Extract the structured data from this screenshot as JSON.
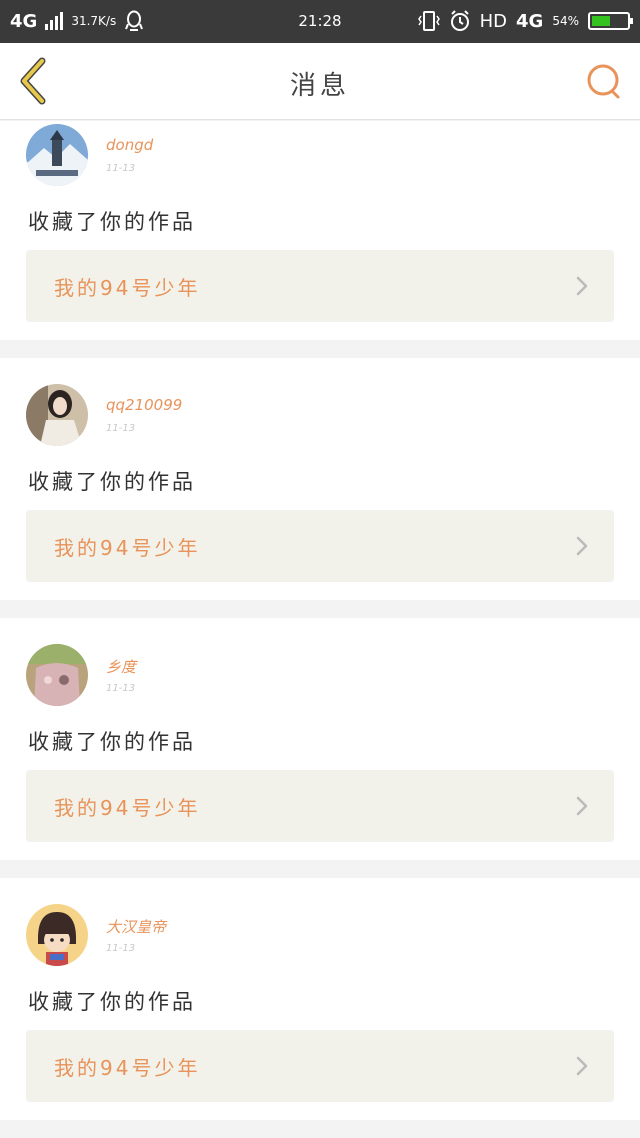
{
  "status_bar": {
    "network": "4G",
    "speed": "31.7K/s",
    "time": "21:28",
    "hd": "HD",
    "network2": "4G",
    "battery_pct": "54%",
    "battery_level": 0.54
  },
  "header": {
    "title": "消息"
  },
  "messages": [
    {
      "username": "dongd",
      "date": "11-13",
      "action": "收藏了你的作品",
      "work_title": "我的94号少年"
    },
    {
      "username": "qq210099",
      "date": "11-13",
      "action": "收藏了你的作品",
      "work_title": "我的94号少年"
    },
    {
      "username": "乡度",
      "date": "11-13",
      "action": "收藏了你的作品",
      "work_title": "我的94号少年"
    },
    {
      "username": "大汉皇帝",
      "date": "11-13",
      "action": "收藏了你的作品",
      "work_title": "我的94号少年"
    }
  ],
  "colors": {
    "accent": "#e8935a",
    "back_icon": "#e8c84a",
    "status_bar_bg": "#3a3a3a"
  }
}
